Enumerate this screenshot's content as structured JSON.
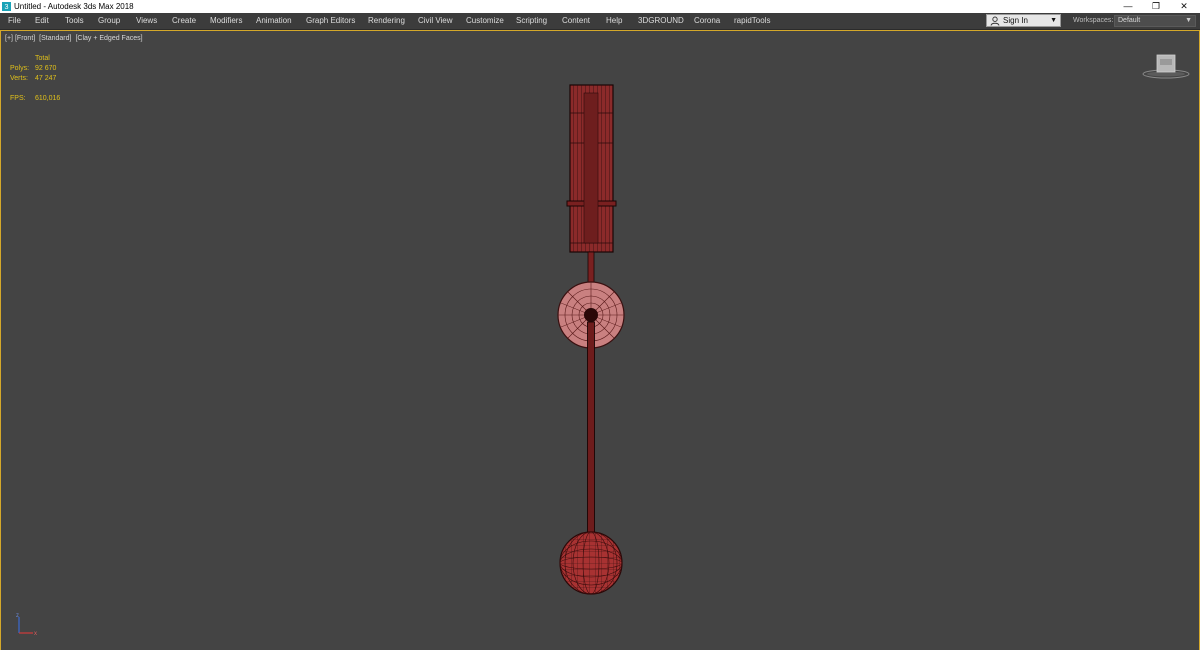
{
  "window": {
    "title": "Untitled - Autodesk 3ds Max 2018",
    "controls": {
      "minimize": "—",
      "maximize": "❐",
      "close": "✕"
    }
  },
  "menu": {
    "items": [
      "File",
      "Edit",
      "Tools",
      "Group",
      "Views",
      "Create",
      "Modifiers",
      "Animation",
      "Graph Editors",
      "Rendering",
      "Civil View",
      "Customize",
      "Scripting",
      "Content",
      "Help",
      "3DGROUND",
      "Corona",
      "rapidTools"
    ],
    "signin_label": "Sign In",
    "workspaces_label": "Workspaces:",
    "workspaces_value": "Default"
  },
  "viewport": {
    "label_plus": "[+]",
    "label_view": "[Front]",
    "label_shading": "[Standard]",
    "label_mode": "[Clay + Edged Faces]",
    "stats": {
      "header": "Total",
      "polys_label": "Polys:",
      "polys_value": "92 670",
      "verts_label": "Verts:",
      "verts_value": "47 247",
      "fps_label": "FPS:",
      "fps_value": "610,016"
    }
  },
  "colors": {
    "viewport_bg": "#444444",
    "active_border": "#d4a82a",
    "stats_text": "#e0c01a",
    "mesh_fill": "#8b2a2a",
    "mesh_wire": "#2a0a0a"
  },
  "icons": {
    "app": "3ds-max-icon",
    "user": "user-icon",
    "dropdown": "chevron-down-icon",
    "viewcube": "viewcube-icon",
    "axis": "axis-tripod-icon"
  }
}
